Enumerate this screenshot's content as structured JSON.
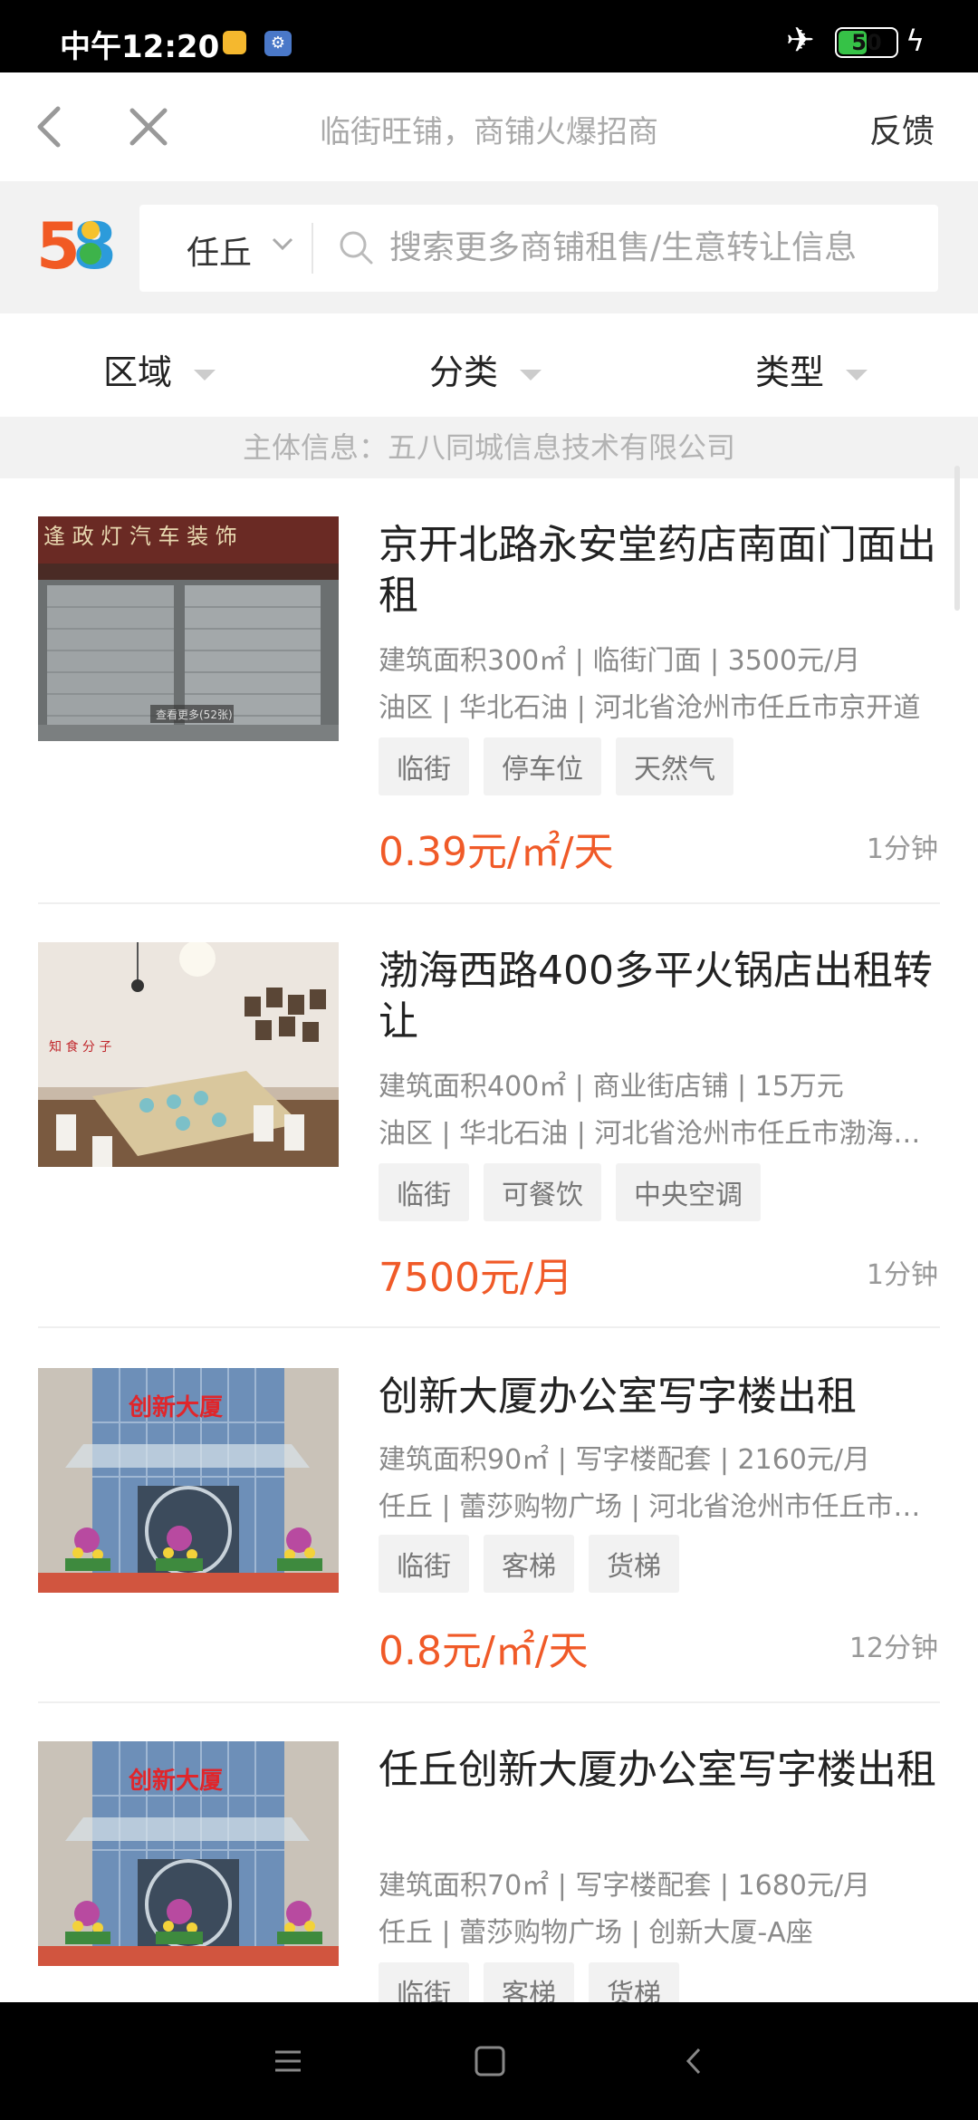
{
  "status_bar": {
    "time": "中午12:20",
    "battery": "50",
    "battery_level": 0.5,
    "icons": [
      "video-icon",
      "settings-icon",
      "airplane-icon",
      "battery-icon",
      "charging-icon"
    ]
  },
  "nav": {
    "title": "临街旺铺，商铺火爆招商",
    "feedback": "反馈",
    "icons": [
      "back-icon",
      "close-icon"
    ]
  },
  "search": {
    "logo_text": "58",
    "city": "任丘",
    "placeholder": "搜索更多商铺租售/生意转让信息"
  },
  "filters": [
    "区域",
    "分类",
    "类型"
  ],
  "subject_info": "主体信息：五八同城信息技术有限公司",
  "listings": [
    {
      "title": "京开北路永安堂药店南面门面出租",
      "meta1": "建筑面积300㎡ | 临街门面 | 3500元/月",
      "meta2": "油区 | 华北石油 | 河北省沧州市任丘市京开道",
      "tags": [
        "临街",
        "停车位",
        "天然气"
      ],
      "price": "0.39元/㎡/天",
      "time": "1分钟"
    },
    {
      "title": "渤海西路400多平火锅店出租转让",
      "meta1": "建筑面积400㎡ | 商业街店铺 | 15万元",
      "meta2": "油区 | 华北石油 | 河北省沧州市任丘市渤海…",
      "tags": [
        "临街",
        "可餐饮",
        "中央空调"
      ],
      "price": "7500元/月",
      "time": "1分钟"
    },
    {
      "title": "创新大厦办公室写字楼出租",
      "meta1": "建筑面积90㎡ | 写字楼配套 | 2160元/月",
      "meta2": "任丘 | 蕾莎购物广场 | 河北省沧州市任丘市…",
      "tags": [
        "临街",
        "客梯",
        "货梯"
      ],
      "price": "0.8元/㎡/天",
      "time": "12分钟"
    },
    {
      "title": "任丘创新大厦办公室写字楼出租",
      "meta1": "建筑面积70㎡ | 写字楼配套 | 1680元/月",
      "meta2": "任丘 | 蕾莎购物广场 | 创新大厦-A座",
      "tags": [
        "临街",
        "客梯",
        "货梯"
      ],
      "price": "",
      "time": ""
    }
  ],
  "image_text": {
    "shop_sign": "逢 政 灯 汽 车 装 饰",
    "watermark": "查看更多(52张)",
    "restaurant_sign": "知 食 分 子",
    "building_sign": "创新大厦"
  },
  "bottom_nav": [
    "menu-icon",
    "home-icon",
    "back-nav-icon"
  ],
  "colors": {
    "accent_price": "#f05a28",
    "tag_bg": "#f2f2f2",
    "battery_green": "#36c247"
  }
}
